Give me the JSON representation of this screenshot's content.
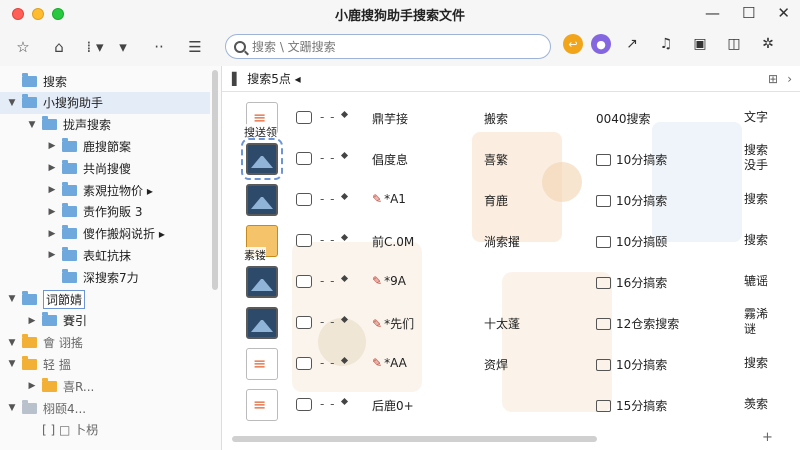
{
  "window": {
    "title": "小鹿搜狗助手搜索文件"
  },
  "toolbar": {
    "search_placeholder": "搜索 \\ 文跚搜索"
  },
  "sidebar": {
    "items": [
      {
        "label": "搜索",
        "indent": 0,
        "arrow": "",
        "folder": "blue"
      },
      {
        "label": "小搜狗助手",
        "indent": 0,
        "arrow": "▼",
        "folder": "blue",
        "selected": true
      },
      {
        "label": "拢声搜索",
        "indent": 1,
        "arrow": "▼",
        "folder": "blue"
      },
      {
        "label": "鹿搜節案",
        "indent": 2,
        "arrow": "▶",
        "folder": "blue"
      },
      {
        "label": "共尚搜傻",
        "indent": 2,
        "arrow": "▶",
        "folder": "blue"
      },
      {
        "label": "素覌拉物价 ▸",
        "indent": 2,
        "arrow": "▶",
        "folder": "blue"
      },
      {
        "label": "责作狗販 3",
        "indent": 2,
        "arrow": "▶",
        "folder": "blue"
      },
      {
        "label": "傻作搬焖说折 ▸",
        "indent": 2,
        "arrow": "▶",
        "folder": "blue"
      },
      {
        "label": "表虹抗抹",
        "indent": 2,
        "arrow": "▶",
        "folder": "blue"
      },
      {
        "label": "深搜索7力",
        "indent": 2,
        "arrow": "",
        "folder": "blue"
      },
      {
        "label": "词節婧",
        "indent": 0,
        "arrow": "▼",
        "folder": "blue",
        "editing": true
      },
      {
        "label": "賽引",
        "indent": 1,
        "arrow": "▶",
        "folder": "blue"
      },
      {
        "label": "會 诩搖",
        "indent": 0,
        "arrow": "▼",
        "folder": "yellow",
        "dim": true
      },
      {
        "label": "轻 搵",
        "indent": 0,
        "arrow": "▼",
        "folder": "yellow",
        "dim": true
      },
      {
        "label": "喜R...",
        "indent": 1,
        "arrow": "▶",
        "folder": "yellow",
        "dim": true
      },
      {
        "label": "栩颐4...",
        "indent": 0,
        "arrow": "▼",
        "folder": "gray",
        "dim": true
      },
      {
        "label": "[  ]  □ 卜枴",
        "indent": 1,
        "arrow": "",
        "folder": "none",
        "dim": true
      }
    ]
  },
  "main": {
    "breadcrumb": "搜索5点 ◂",
    "rows": [
      {
        "thumb": "doc",
        "thumb_label": "搜送领",
        "c1": "鼎芋接",
        "c1_pen": false,
        "c2": "搬索",
        "c3": "0040搜索",
        "c3_folder": false,
        "c4": "文字"
      },
      {
        "thumb": "image",
        "thumb_label": "",
        "c1": "倡度息",
        "c1_pen": false,
        "c2": "喜繁",
        "c3": "10分搞索",
        "c3_folder": true,
        "c4": "搜索\n没手"
      },
      {
        "thumb": "image",
        "thumb_label": "",
        "c1": "*A1",
        "c1_pen": true,
        "c2": "育鹿",
        "c3": "10分搞索",
        "c3_folder": true,
        "c4": "搜索"
      },
      {
        "thumb": "app",
        "thumb_label": "素镂",
        "c1": "前C.0M",
        "c1_pen": false,
        "c2": "淌索擢",
        "c3": "10分搞颐",
        "c3_folder": true,
        "c4": "搜索"
      },
      {
        "thumb": "image",
        "thumb_label": "",
        "c1": "*9A",
        "c1_pen": true,
        "c2": "",
        "c3": "16分搞索",
        "c3_folder": true,
        "c4": "辘谣"
      },
      {
        "thumb": "image",
        "thumb_label": "",
        "c1": "*先们",
        "c1_pen": true,
        "c2": "十太蓬",
        "c3": "12仓索搜索",
        "c3_folder": true,
        "c4": "霧浠\n谜"
      },
      {
        "thumb": "file",
        "thumb_label": "",
        "c1": "*AA",
        "c1_pen": true,
        "c2": "资焊",
        "c3": "10分搞索",
        "c3_folder": true,
        "c4": "搜索"
      },
      {
        "thumb": "doc",
        "thumb_label": "",
        "c1": "后鹿0+",
        "c1_pen": false,
        "c2": "",
        "c3": "15分搞索",
        "c3_folder": true,
        "c4": "羡索"
      }
    ]
  },
  "colors": {
    "accent": "#6d95d6",
    "folder_blue": "#6fa8dc",
    "folder_yellow": "#f2b136"
  }
}
